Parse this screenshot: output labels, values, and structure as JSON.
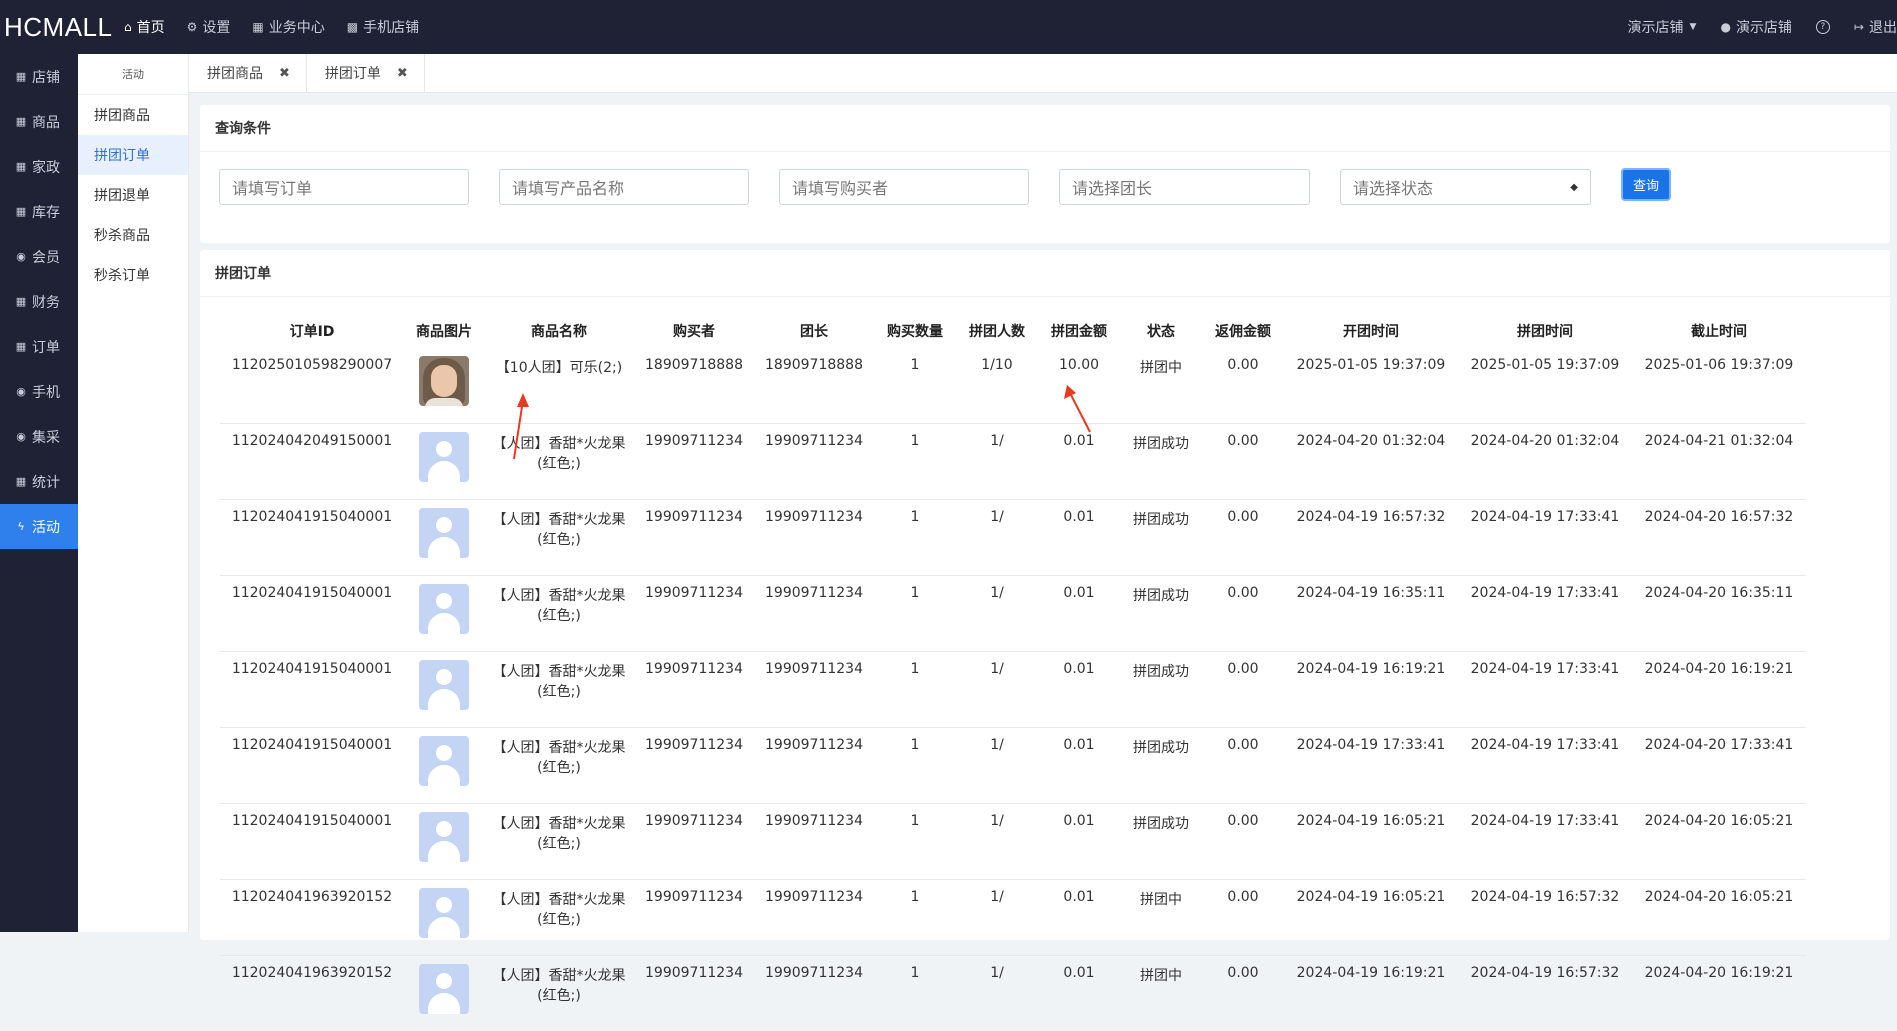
{
  "header": {
    "brand": "HCMALL",
    "nav": [
      "首页",
      "设置",
      "业务中心",
      "手机店铺"
    ],
    "right": {
      "store_menu": "演示店铺",
      "user": "演示店铺",
      "help_icon": "?",
      "logout": "退出"
    }
  },
  "leftnav": [
    "店铺",
    "商品",
    "家政",
    "库存",
    "会员",
    "财务",
    "订单",
    "手机",
    "集采",
    "统计",
    "活动"
  ],
  "subnav": {
    "title": "活动",
    "items": [
      "拼团商品",
      "拼团订单",
      "拼团退单",
      "秒杀商品",
      "秒杀订单"
    ]
  },
  "tabs": [
    {
      "label": "拼团商品"
    },
    {
      "label": "拼团订单"
    }
  ],
  "query": {
    "title": "查询条件",
    "order_placeholder": "请填写订单",
    "product_placeholder": "请填写产品名称",
    "buyer_placeholder": "请填写购买者",
    "leader_placeholder": "请选择团长",
    "status_placeholder": "请选择状态",
    "search_label": "查询"
  },
  "orders": {
    "title": "拼团订单",
    "columns": [
      "订单ID",
      "商品图片",
      "商品名称",
      "购买者",
      "团长",
      "购买数量",
      "拼团人数",
      "拼团金额",
      "状态",
      "返佣金额",
      "开团时间",
      "拼团时间",
      "截止时间"
    ],
    "rows": [
      {
        "id": "112025010598290007",
        "image": "portrait",
        "name": "【10人团】可乐(2;)",
        "buyer": "18909718888",
        "leader": "18909718888",
        "qty": "1",
        "people": "1/10",
        "amount": "10.00",
        "status": "拼团中",
        "rebate": "0.00",
        "open": "2025-01-05 19:37:09",
        "group": "2025-01-05 19:37:09",
        "end": "2025-01-06 19:37:09"
      },
      {
        "id": "112024042049150001",
        "image": "placeholder",
        "name": "【人团】香甜*火龙果(红色;)",
        "buyer": "19909711234",
        "leader": "19909711234",
        "qty": "1",
        "people": "1/",
        "amount": "0.01",
        "status": "拼团成功",
        "rebate": "0.00",
        "open": "2024-04-20 01:32:04",
        "group": "2024-04-20 01:32:04",
        "end": "2024-04-21 01:32:04"
      },
      {
        "id": "112024041915040001",
        "image": "placeholder",
        "name": "【人团】香甜*火龙果(红色;)",
        "buyer": "19909711234",
        "leader": "19909711234",
        "qty": "1",
        "people": "1/",
        "amount": "0.01",
        "status": "拼团成功",
        "rebate": "0.00",
        "open": "2024-04-19 16:57:32",
        "group": "2024-04-19 17:33:41",
        "end": "2024-04-20 16:57:32"
      },
      {
        "id": "112024041915040001",
        "image": "placeholder",
        "name": "【人团】香甜*火龙果(红色;)",
        "buyer": "19909711234",
        "leader": "19909711234",
        "qty": "1",
        "people": "1/",
        "amount": "0.01",
        "status": "拼团成功",
        "rebate": "0.00",
        "open": "2024-04-19 16:35:11",
        "group": "2024-04-19 17:33:41",
        "end": "2024-04-20 16:35:11"
      },
      {
        "id": "112024041915040001",
        "image": "placeholder",
        "name": "【人团】香甜*火龙果(红色;)",
        "buyer": "19909711234",
        "leader": "19909711234",
        "qty": "1",
        "people": "1/",
        "amount": "0.01",
        "status": "拼团成功",
        "rebate": "0.00",
        "open": "2024-04-19 16:19:21",
        "group": "2024-04-19 17:33:41",
        "end": "2024-04-20 16:19:21"
      },
      {
        "id": "112024041915040001",
        "image": "placeholder",
        "name": "【人团】香甜*火龙果(红色;)",
        "buyer": "19909711234",
        "leader": "19909711234",
        "qty": "1",
        "people": "1/",
        "amount": "0.01",
        "status": "拼团成功",
        "rebate": "0.00",
        "open": "2024-04-19 17:33:41",
        "group": "2024-04-19 17:33:41",
        "end": "2024-04-20 17:33:41"
      },
      {
        "id": "112024041915040001",
        "image": "placeholder",
        "name": "【人团】香甜*火龙果(红色;)",
        "buyer": "19909711234",
        "leader": "19909711234",
        "qty": "1",
        "people": "1/",
        "amount": "0.01",
        "status": "拼团成功",
        "rebate": "0.00",
        "open": "2024-04-19 16:05:21",
        "group": "2024-04-19 17:33:41",
        "end": "2024-04-20 16:05:21"
      },
      {
        "id": "112024041963920152",
        "image": "placeholder",
        "name": "【人团】香甜*火龙果(红色;)",
        "buyer": "19909711234",
        "leader": "19909711234",
        "qty": "1",
        "people": "1/",
        "amount": "0.01",
        "status": "拼团中",
        "rebate": "0.00",
        "open": "2024-04-19 16:05:21",
        "group": "2024-04-19 16:57:32",
        "end": "2024-04-20 16:05:21"
      },
      {
        "id": "112024041963920152",
        "image": "placeholder",
        "name": "【人团】香甜*火龙果(红色;)",
        "buyer": "19909711234",
        "leader": "19909711234",
        "qty": "1",
        "people": "1/",
        "amount": "0.01",
        "status": "拼团中",
        "rebate": "0.00",
        "open": "2024-04-19 16:19:21",
        "group": "2024-04-19 16:57:32",
        "end": "2024-04-20 16:19:21"
      }
    ]
  },
  "colors": {
    "topbar": "#1f2235",
    "accent": "#2f80ed",
    "button": "#1a73e8",
    "annotation_arrow": "#e83a1f"
  }
}
